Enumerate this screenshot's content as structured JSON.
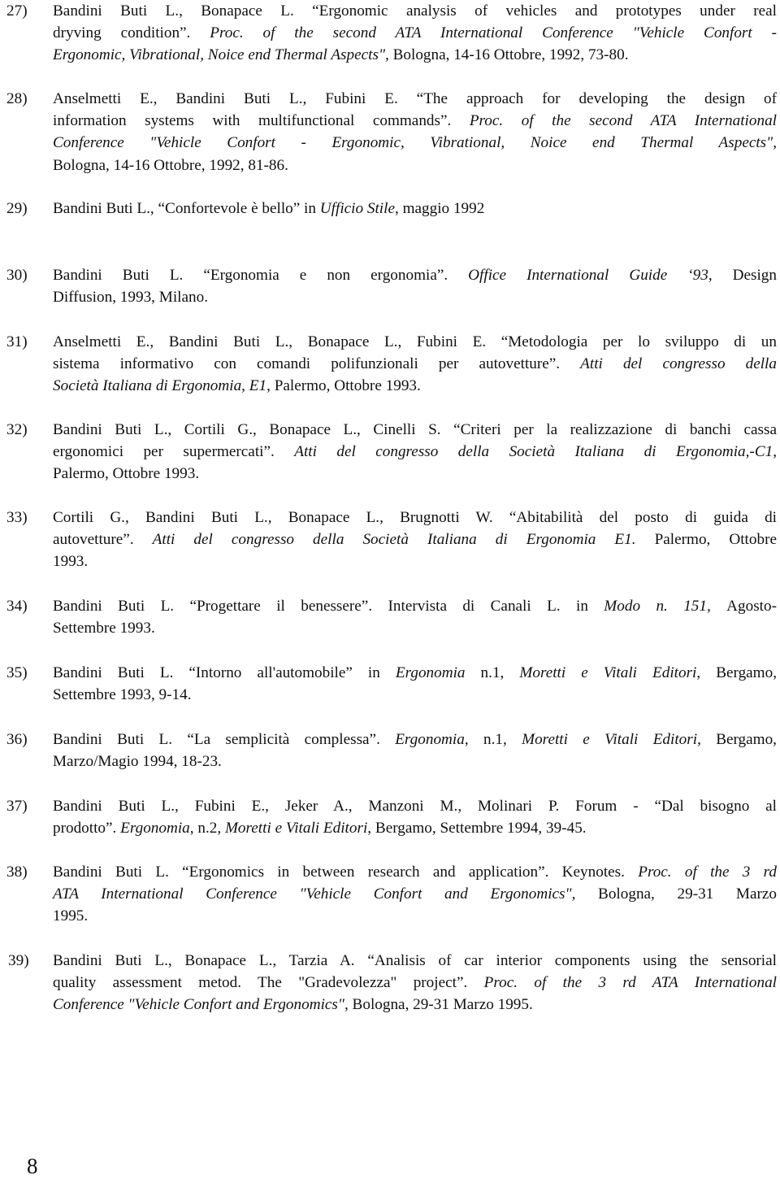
{
  "document": {
    "type": "bibliography-page",
    "page_number": "8",
    "entries": [
      {
        "number": "27)",
        "lines": [
          [
            {
              "t": "Bandini Buti L., Bonapace L. “Ergonomic analysis of vehicles and prototypes under real",
              "i": false
            }
          ],
          [
            {
              "t": "dryving condition”. ",
              "i": false
            },
            {
              "t": "Proc. of the second ATA International Conference \"Vehicle Confort -",
              "i": true
            }
          ],
          [
            {
              "t": "Ergonomic, Vibrational, Noice end Thermal Aspects\",",
              "i": true
            },
            {
              "t": "  Bologna, 14-16 Ottobre, 1992, 73-80.",
              "i": false
            }
          ]
        ]
      },
      {
        "number": "28)",
        "lines": [
          [
            {
              "t": "Anselmetti E., Bandini Buti L., Fubini E. “The approach for developing the design of",
              "i": false
            }
          ],
          [
            {
              "t": "information systems with multifunctional commands”. ",
              "i": false
            },
            {
              "t": "Proc. of the second ATA International",
              "i": true
            }
          ],
          [
            {
              "t": "Conference \"Vehicle Confort - Ergonomic, Vibrational, Noice end Thermal Aspects\",",
              "i": true
            }
          ],
          [
            {
              "t": "Bologna, 14-16 Ottobre, 1992, 81-86.",
              "i": false
            }
          ]
        ]
      },
      {
        "number": "29)",
        "lines": [
          [
            {
              "t": "Bandini Buti L., “Confortevole è bello” in ",
              "i": false
            },
            {
              "t": "Ufficio Stile",
              "i": true
            },
            {
              "t": ", maggio 1992",
              "i": false
            }
          ]
        ]
      },
      {
        "number": "30)",
        "lines": [
          [
            {
              "t": "Bandini Buti L. “Ergonomia e non ergonomia”. ",
              "i": false
            },
            {
              "t": "Office International Guide ‘93, ",
              "i": true
            },
            {
              "t": " Design",
              "i": false
            }
          ],
          [
            {
              "t": "Diffusion, 1993, Milano.",
              "i": false
            }
          ]
        ]
      },
      {
        "number": "31)",
        "lines": [
          [
            {
              "t": "Anselmetti E., Bandini Buti L., Bonapace L., Fubini E. “Metodologia per lo sviluppo di un",
              "i": false
            }
          ],
          [
            {
              "t": "sistema informativo con comandi polifunzionali per autovetture”. ",
              "i": false
            },
            {
              "t": "Atti del congresso della",
              "i": true
            }
          ],
          [
            {
              "t": "Società Italiana di Ergonomia, E1",
              "i": true
            },
            {
              "t": ", Palermo, Ottobre 1993.",
              "i": false
            }
          ]
        ]
      },
      {
        "number": "32)",
        "lines": [
          [
            {
              "t": "Bandini Buti L., Cortili G., Bonapace L., Cinelli S. “Criteri per la realizzazione di banchi cassa",
              "i": false
            }
          ],
          [
            {
              "t": "ergonomici per supermercati”. ",
              "i": false
            },
            {
              "t": "Atti del congresso della Società Italiana di Ergonomia,-C1",
              "i": true
            },
            {
              "t": ",",
              "i": false
            }
          ],
          [
            {
              "t": "Palermo, Ottobre 1993.",
              "i": false
            }
          ]
        ]
      },
      {
        "number": "33)",
        "lines": [
          [
            {
              "t": "Cortili G., Bandini Buti L., Bonapace L., Brugnotti W. “Abitabilità del posto di guida di",
              "i": false
            }
          ],
          [
            {
              "t": "autovetture”. ",
              "i": false
            },
            {
              "t": "Atti del congresso della Società Italiana di Ergonomia E1.",
              "i": true
            },
            {
              "t": "  Palermo, Ottobre",
              "i": false
            }
          ],
          [
            {
              "t": "1993.",
              "i": false
            }
          ]
        ]
      },
      {
        "number": "34)",
        "lines": [
          [
            {
              "t": "Bandini Buti L.  “Progettare il benessere”. Intervista di Canali L. in ",
              "i": false
            },
            {
              "t": "Modo n. 151, ",
              "i": true
            },
            {
              "t": " Agosto-",
              "i": false
            }
          ],
          [
            {
              "t": "Settembre 1993.",
              "i": false
            }
          ]
        ]
      },
      {
        "number": "35)",
        "lines": [
          [
            {
              "t": "Bandini Buti L. “Intorno all'automobile” in  ",
              "i": false
            },
            {
              "t": "Ergonomia",
              "i": true
            },
            {
              "t": " n.1, ",
              "i": false
            },
            {
              "t": "Moretti e Vitali Editori",
              "i": true
            },
            {
              "t": ", Bergamo,",
              "i": false
            }
          ],
          [
            {
              "t": "Settembre 1993, 9-14.",
              "i": false
            }
          ]
        ]
      },
      {
        "number": "36)",
        "lines": [
          [
            {
              "t": "Bandini Buti L. “La semplicità complessa”. ",
              "i": false
            },
            {
              "t": "Ergonomia",
              "i": true
            },
            {
              "t": ", n.1,  ",
              "i": false
            },
            {
              "t": "Moretti e Vitali Editori",
              "i": true
            },
            {
              "t": ", Bergamo,",
              "i": false
            }
          ],
          [
            {
              "t": "Marzo/Magio 1994, 18-23.",
              "i": false
            }
          ]
        ]
      },
      {
        "number": "37)",
        "lines": [
          [
            {
              "t": "Bandini Buti L., Fubini E., Jeker A., Manzoni M., Molinari P. Forum - “Dal bisogno al",
              "i": false
            }
          ],
          [
            {
              "t": "prodotto”. ",
              "i": false
            },
            {
              "t": "Ergonomia",
              "i": true
            },
            {
              "t": ", n.2",
              "i": false
            },
            {
              "t": ", Moretti e Vitali Editori",
              "i": true
            },
            {
              "t": ", Bergamo, Settembre 1994, 39-45.",
              "i": false
            }
          ]
        ]
      },
      {
        "number": "38)",
        "lines": [
          [
            {
              "t": "Bandini Buti L. “Ergonomics in between research and application”. Keynotes.  ",
              "i": false
            },
            {
              "t": "Proc. of the 3 rd",
              "i": true
            }
          ],
          [
            {
              "t": "ATA International Conference \"Vehicle Confort and Ergonomics\",",
              "i": true
            },
            {
              "t": "   Bologna, 29-31 Marzo",
              "i": false
            }
          ],
          [
            {
              "t": "1995.",
              "i": false
            }
          ]
        ]
      },
      {
        "number": "39)",
        "lines": [
          [
            {
              "t": "Bandini Buti L., Bonapace L., Tarzia A. “Analisis of car interior components using the sensorial",
              "i": false
            }
          ],
          [
            {
              "t": "quality assessment metod. The \"Gradevolezza\" project”.  ",
              "i": false
            },
            {
              "t": "Proc. of the 3 rd ATA International",
              "i": true
            }
          ],
          [
            {
              "t": "Conference \"Vehicle Confort and Ergonomics\",",
              "i": true
            },
            {
              "t": "   Bologna,  29-31 Marzo 1995.",
              "i": false
            }
          ]
        ]
      }
    ]
  }
}
